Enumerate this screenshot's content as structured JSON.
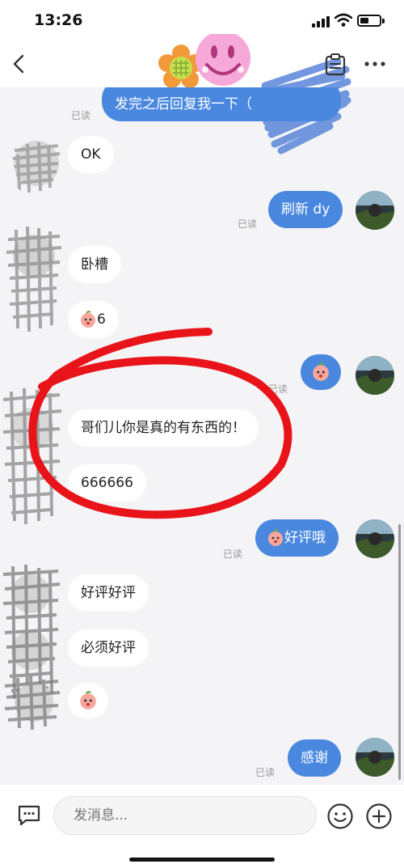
{
  "status_bar": {
    "time": "13:26"
  },
  "header": {
    "back_icon": "chevron-left-icon",
    "note_icon": "clipboard-icon",
    "more_icon": "ellipsis-icon"
  },
  "messages": {
    "m0": {
      "text": "发完之后回复我一下（",
      "read": "已读"
    },
    "m1": {
      "text": "OK"
    },
    "m2": {
      "text": "刷新 dy",
      "read": "已读"
    },
    "m3": {
      "text": "卧槽"
    },
    "m4": {
      "text": "6"
    },
    "m5": {
      "read": "已读"
    },
    "m6": {
      "text": "哥们儿你是真的有东西的！"
    },
    "m7": {
      "text": "666666"
    },
    "m8": {
      "text": "好评哦",
      "read": "已读"
    },
    "m9": {
      "text": "好评好评"
    },
    "m10": {
      "text": "必须好评"
    },
    "m12": {
      "text": "感谢",
      "read": "已读"
    }
  },
  "input": {
    "placeholder": "发消息..."
  },
  "colors": {
    "outgoing_bubble": "#4a88df",
    "incoming_bubble": "#ffffff",
    "background": "#f4f4f6",
    "annotation": "#e8141a"
  }
}
